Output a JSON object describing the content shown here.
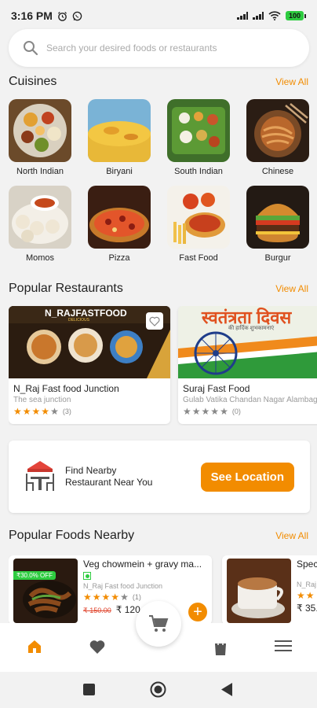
{
  "status_bar": {
    "time": "3:16 PM",
    "battery": "100"
  },
  "search": {
    "placeholder": "Search your desired foods or restaurants"
  },
  "cuisines": {
    "title": "Cuisines",
    "view_all": "View All",
    "items": [
      {
        "label": "North Indian"
      },
      {
        "label": "Biryani"
      },
      {
        "label": "South Indian"
      },
      {
        "label": "Chinese"
      },
      {
        "label": "Momos"
      },
      {
        "label": "Pizza"
      },
      {
        "label": "Fast Food"
      },
      {
        "label": "Burgur"
      }
    ]
  },
  "popular_restaurants": {
    "title": "Popular Restaurants",
    "view_all": "View All",
    "items": [
      {
        "name": "N_Raj Fast food Junction",
        "address": "The sea junction",
        "rating": 4,
        "reviews": "(3)",
        "banner_text": "N_RAJFASTFOOD",
        "banner_sub": "DELICIOUS"
      },
      {
        "name": "Suraj Fast Food",
        "address": "Gulab Vatika Chandan Nagar Alambag",
        "rating": 0,
        "reviews": "(0)",
        "banner_text": "स्वतंत्रता दिवस",
        "banner_sub": "की हार्दिक शुभकामनाएं"
      }
    ]
  },
  "location_card": {
    "text_line1": "Find Nearby",
    "text_line2": "Restaurant Near You",
    "button": "See Location"
  },
  "popular_foods": {
    "title": "Popular Foods Nearby",
    "view_all": "View All",
    "items": [
      {
        "name": "Veg chowmein + gravy ma...",
        "restaurant": "N_Raj Fast food Junction",
        "rating": 4,
        "reviews": "(1)",
        "old_price": "₹ 150.00",
        "new_price": "₹ 120",
        "discount": "₹30.0% OFF"
      },
      {
        "name": "Speci",
        "restaurant": "N_Raj",
        "rating": 2,
        "reviews": "",
        "old_price": "",
        "new_price": "₹ 35.0",
        "discount": ""
      }
    ]
  },
  "colors": {
    "accent": "#f28c00",
    "veg": "#2ecc40",
    "old_price": "#e0442c"
  },
  "bottom_nav": {
    "items": [
      "home-icon",
      "heart-icon",
      "cart-icon",
      "bag-icon",
      "menu-icon"
    ]
  }
}
